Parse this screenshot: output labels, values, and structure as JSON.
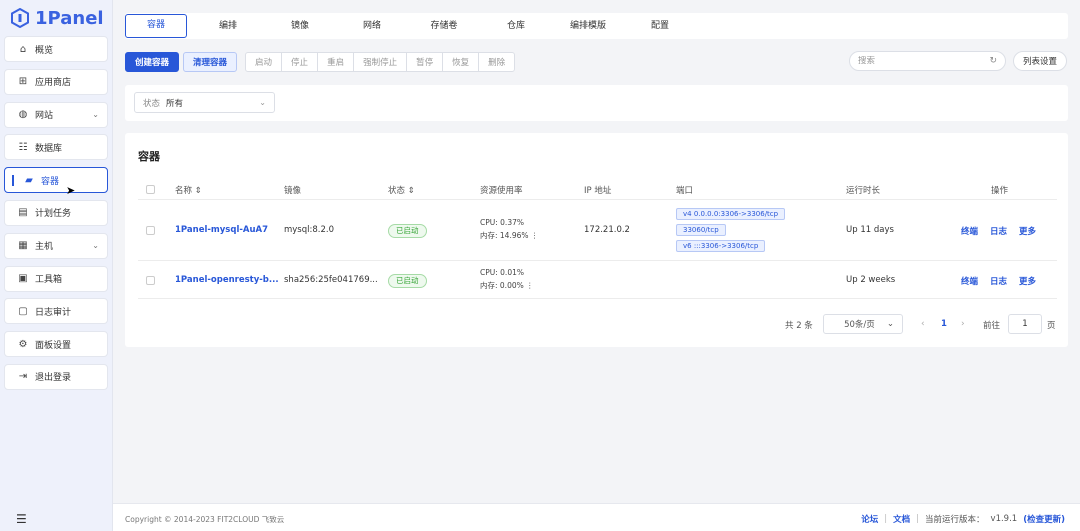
{
  "app": {
    "name": "1Panel"
  },
  "sidebar": {
    "items": [
      {
        "label": "概览",
        "icon": "home-icon"
      },
      {
        "label": "应用商店",
        "icon": "grid-icon"
      },
      {
        "label": "网站",
        "icon": "globe-icon",
        "expandable": true
      },
      {
        "label": "数据库",
        "icon": "database-icon"
      },
      {
        "label": "容器",
        "icon": "docker-icon",
        "active": true
      },
      {
        "label": "计划任务",
        "icon": "calendar-icon"
      },
      {
        "label": "主机",
        "icon": "host-icon",
        "expandable": true
      },
      {
        "label": "工具箱",
        "icon": "toolbox-icon"
      },
      {
        "label": "日志审计",
        "icon": "log-icon"
      },
      {
        "label": "面板设置",
        "icon": "settings-icon"
      },
      {
        "label": "退出登录",
        "icon": "logout-icon"
      }
    ]
  },
  "tabs": [
    "容器",
    "编排",
    "镜像",
    "网络",
    "存储卷",
    "仓库",
    "编排模版",
    "配置"
  ],
  "toolbar": {
    "create": "创建容器",
    "prune": "清理容器",
    "actions": [
      "启动",
      "停止",
      "重启",
      "强制停止",
      "暂停",
      "恢复",
      "删除"
    ],
    "search_placeholder": "搜索",
    "column_settings": "列表设置"
  },
  "filter": {
    "label": "状态",
    "value": "所有"
  },
  "card": {
    "title": "容器"
  },
  "table": {
    "headers": [
      "名称",
      "镜像",
      "状态",
      "资源使用率",
      "IP 地址",
      "端口",
      "运行时长",
      "操作"
    ],
    "rows": [
      {
        "name": "1Panel-mysql-AuA7",
        "image": "mysql:8.2.0",
        "status": "已启动",
        "cpu": "CPU: 0.37%",
        "mem": "内存: 14.96%",
        "ip": "172.21.0.2",
        "ports": [
          "v4 0.0.0.0:3306->3306/tcp",
          "33060/tcp",
          "v6 :::3306->3306/tcp"
        ],
        "uptime": "Up 11 days",
        "ops": [
          "终端",
          "日志",
          "更多"
        ]
      },
      {
        "name": "1Panel-openresty-b...",
        "image": "sha256:25fe041769...",
        "status": "已启动",
        "cpu": "CPU: 0.01%",
        "mem": "内存: 0.00%",
        "ip": "",
        "ports": [],
        "uptime": "Up 2 weeks",
        "ops": [
          "终端",
          "日志",
          "更多"
        ]
      }
    ]
  },
  "pagination": {
    "total": "共 2 条",
    "page_size": "50条/页",
    "current": "1",
    "goto": "前往",
    "goto_value": "1",
    "page_suffix": "页"
  },
  "footer": {
    "copyright": "Copyright © 2014-2023 FIT2CLOUD 飞致云",
    "forum": "论坛",
    "docs": "文档",
    "version_label": "当前运行版本：",
    "version": "v1.9.1",
    "check_update": "(检查更新)"
  },
  "colors": {
    "primary": "#2857d8",
    "success": "#3aa63a"
  }
}
